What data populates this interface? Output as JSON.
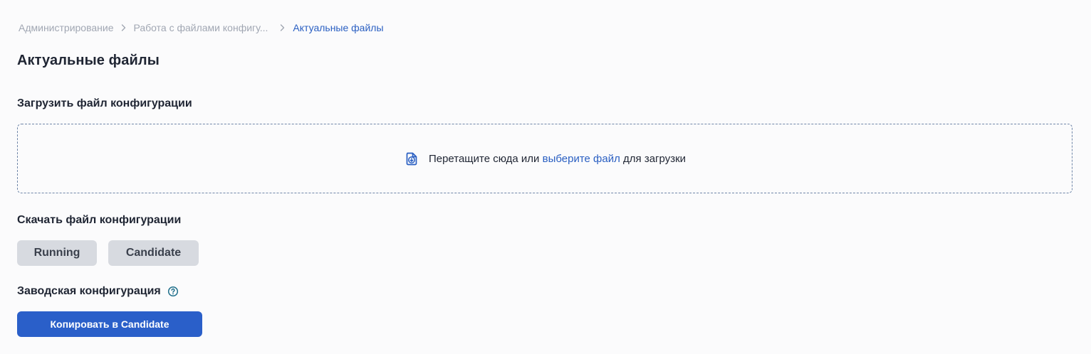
{
  "breadcrumb": {
    "items": [
      {
        "label": "Администрирование"
      },
      {
        "label": "Работа с файлами конфигу..."
      },
      {
        "label": "Актуальные файлы"
      }
    ]
  },
  "page": {
    "title": "Актуальные файлы"
  },
  "upload": {
    "title": "Загрузить файл конфигурации",
    "dropzone": {
      "icon": "file-download-icon",
      "text_before": "Перетащите сюда или ",
      "link_label": "выберите файл",
      "text_after": " для загрузки"
    }
  },
  "download": {
    "title": "Скачать файл конфигурации",
    "running_label": "Running",
    "candidate_label": "Candidate"
  },
  "factory": {
    "title": "Заводская конфигурация",
    "help_icon": "help-circle-icon",
    "copy_label": "Копировать в Candidate"
  },
  "colors": {
    "accent": "#2a5fc9",
    "link": "#2a5fc2",
    "help_icon": "#1f6f8b",
    "gray_button": "#d7dae0",
    "background": "#fbfbfc"
  }
}
